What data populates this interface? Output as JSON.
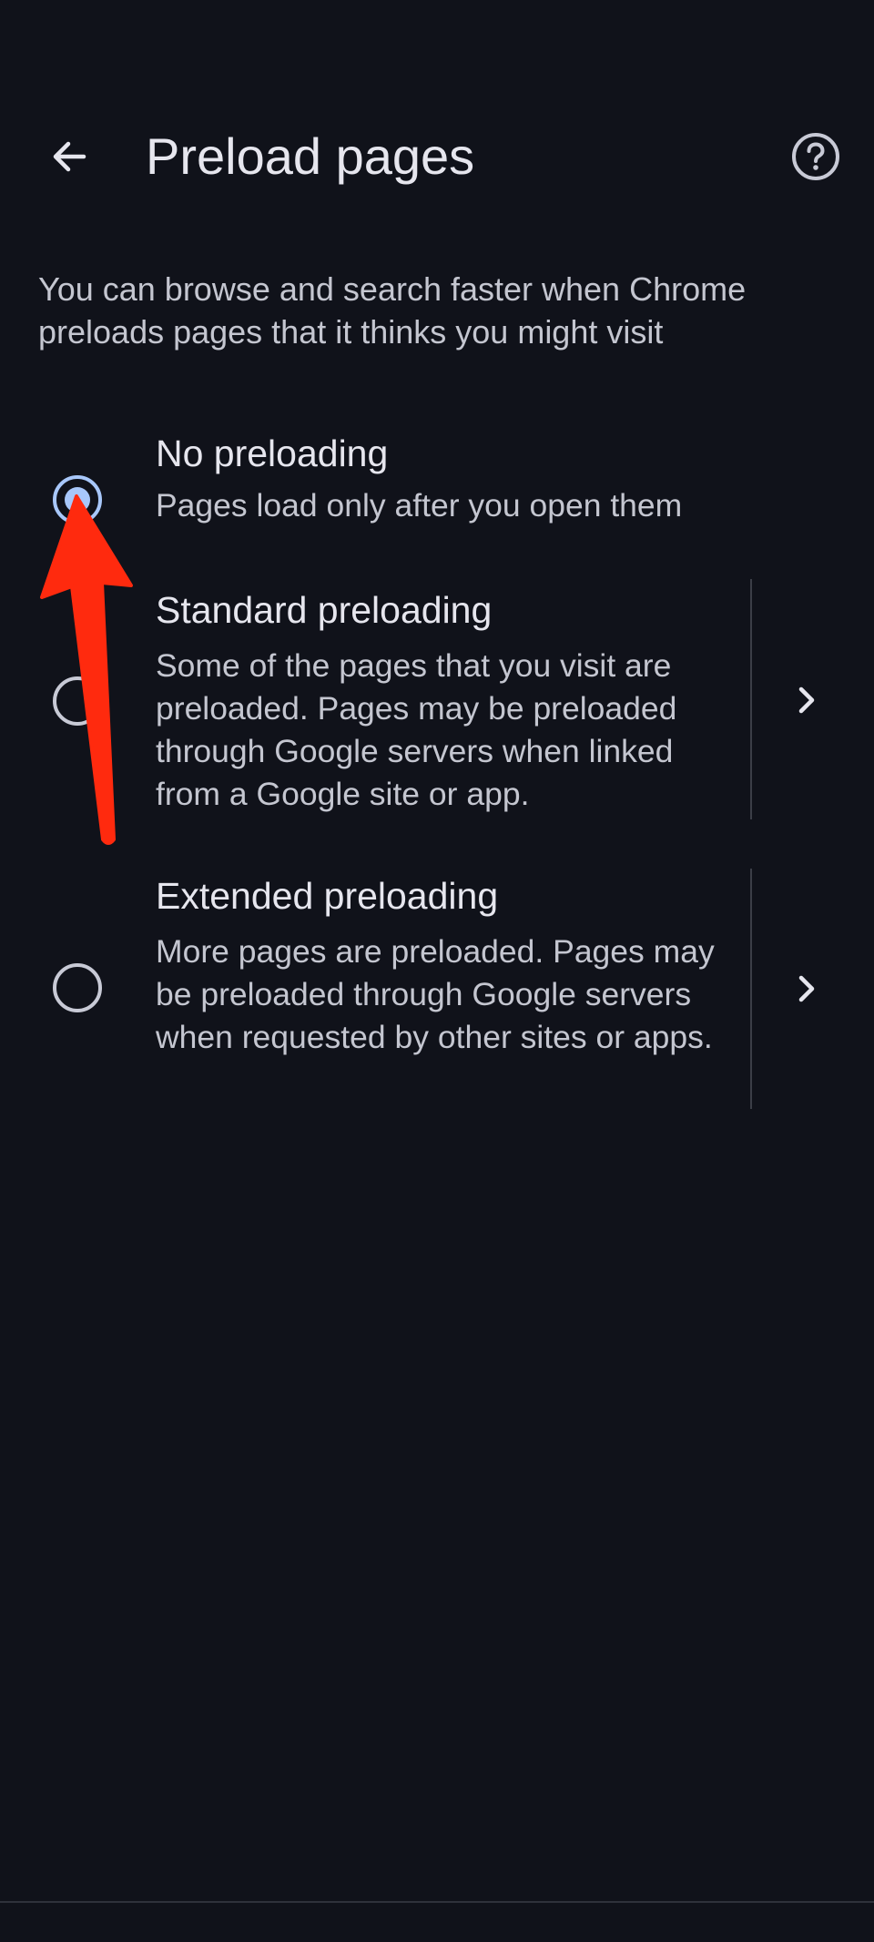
{
  "header": {
    "back_icon": "arrow-back-icon",
    "title": "Preload pages",
    "help_icon": "help-circle-icon"
  },
  "description": "You can browse and search faster when Chrome preloads pages that it thinks you might visit",
  "options": [
    {
      "title": "No preloading",
      "description": "Pages load only after you open them",
      "selected": true
    },
    {
      "title": "Standard preloading",
      "description": "Some of the pages that you visit are preloaded. Pages may be preloaded through Google servers when linked from a Google site or app.",
      "selected": false,
      "details_icon": "chevron-right-icon"
    },
    {
      "title": "Extended preloading",
      "description": "More pages are preloaded. Pages may be preloaded through Google servers when requested by other sites or apps.",
      "selected": false,
      "details_icon": "chevron-right-icon"
    }
  ],
  "annotation": {
    "type": "red-arrow",
    "color": "#ff2a0e",
    "points_to": "No preloading"
  },
  "colors": {
    "background": "#10121a",
    "accent": "#a8c7fa",
    "text_primary": "#e6e6ee",
    "text_secondary": "#c4c6d0"
  }
}
